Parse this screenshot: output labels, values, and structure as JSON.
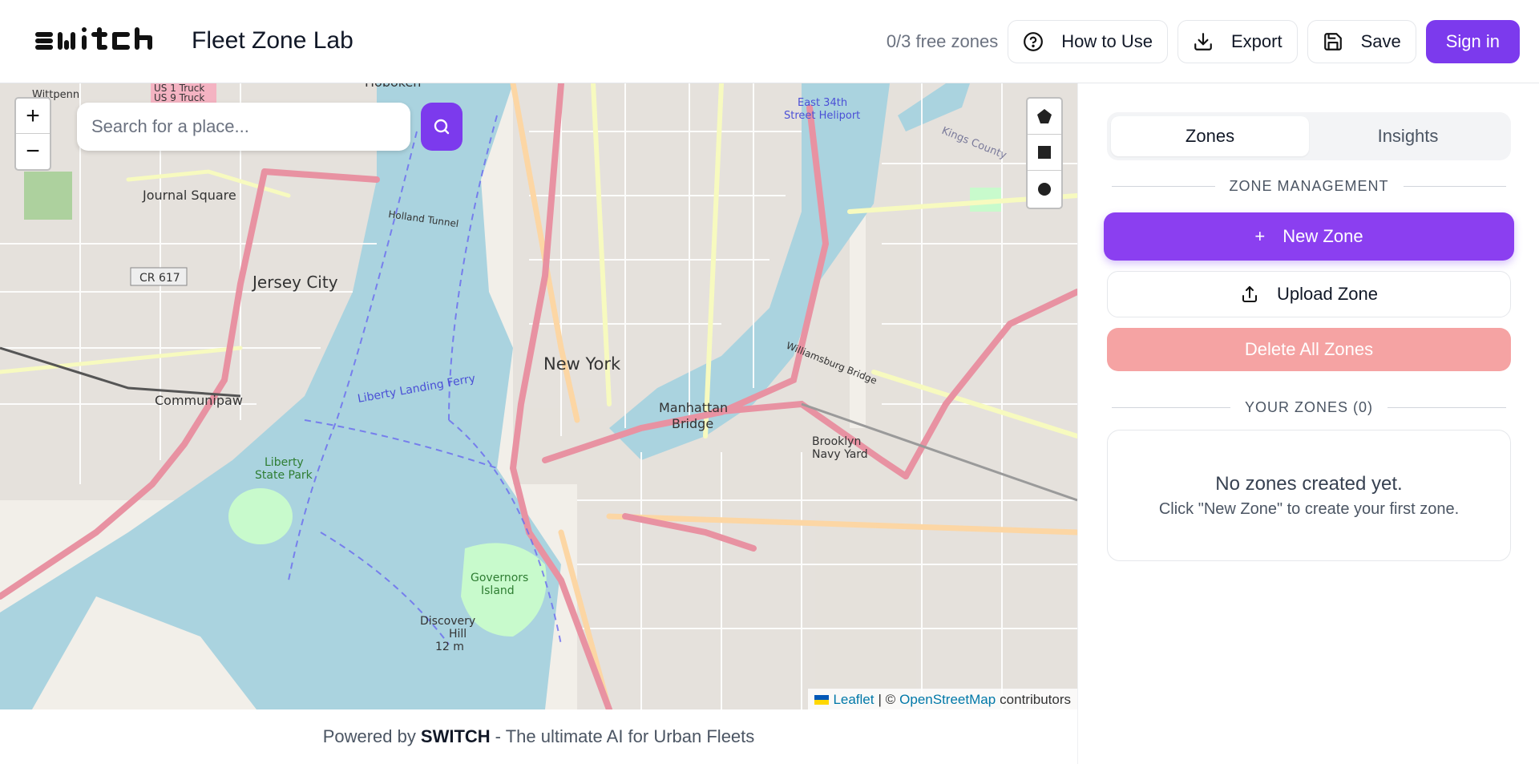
{
  "header": {
    "logo_text": "SWITCH",
    "app_title": "Fleet Zone Lab",
    "free_zones": "0/3 free zones",
    "how_to_use_label": "How to Use",
    "export_label": "Export",
    "save_label": "Save",
    "sign_in_label": "Sign in"
  },
  "map": {
    "search_placeholder": "Search for a place...",
    "zoom_in": "+",
    "zoom_out": "−",
    "place_labels": {
      "new_york": "New York",
      "jersey_city": "Jersey City",
      "journal_square": "Journal Square",
      "communipaw": "Communipaw",
      "manhattan_bridge": "Manhattan\nBridge",
      "liberty_state_park": "Liberty State Park",
      "governors_island": "Governors Island",
      "discovery_hill": "Discovery Hill 12 m",
      "brooklyn_navy_yard": "Brooklyn Navy Yard",
      "cr617": "CR 617",
      "holland_tunnel": "Holland Tunnel",
      "williamsburg_bridge": "Williamsburg Bridge",
      "liberty_landing_ferry": "Liberty Landing Ferry",
      "east_34th_heliport": "East 34th Street Heliport",
      "kings_county": "Kings County",
      "us1_truck": "US 1 Truck",
      "us9_truck": "US 9 Truck",
      "hoboken": "Hoboken",
      "wittpenn_bridge": "Wittpenn Bridge"
    },
    "attribution": {
      "leaflet": "Leaflet",
      "separator": "| ©",
      "osm": "OpenStreetMap",
      "contributors": "contributors"
    }
  },
  "footer": {
    "prefix": "Powered by",
    "brand": "SWITCH",
    "suffix": "- The ultimate AI for Urban Fleets"
  },
  "panel": {
    "tabs": [
      {
        "label": "Zones",
        "active": true
      },
      {
        "label": "Insights",
        "active": false
      }
    ],
    "zone_management_title": "ZONE MANAGEMENT",
    "new_zone_label": "New Zone",
    "new_zone_plus": "+",
    "upload_zone_label": "Upload Zone",
    "delete_all_label": "Delete All Zones",
    "your_zones_title": "YOUR ZONES (0)",
    "empty_title": "No zones created yet.",
    "empty_hint": "Click \"New Zone\" to create your first zone."
  },
  "colors": {
    "accent": "#7c3aed",
    "danger_soft": "#f5a3a3",
    "water": "#aad3df",
    "motorway": "#e892a2",
    "primary_road": "#fcd6a4",
    "secondary_road": "#f7fabf"
  }
}
